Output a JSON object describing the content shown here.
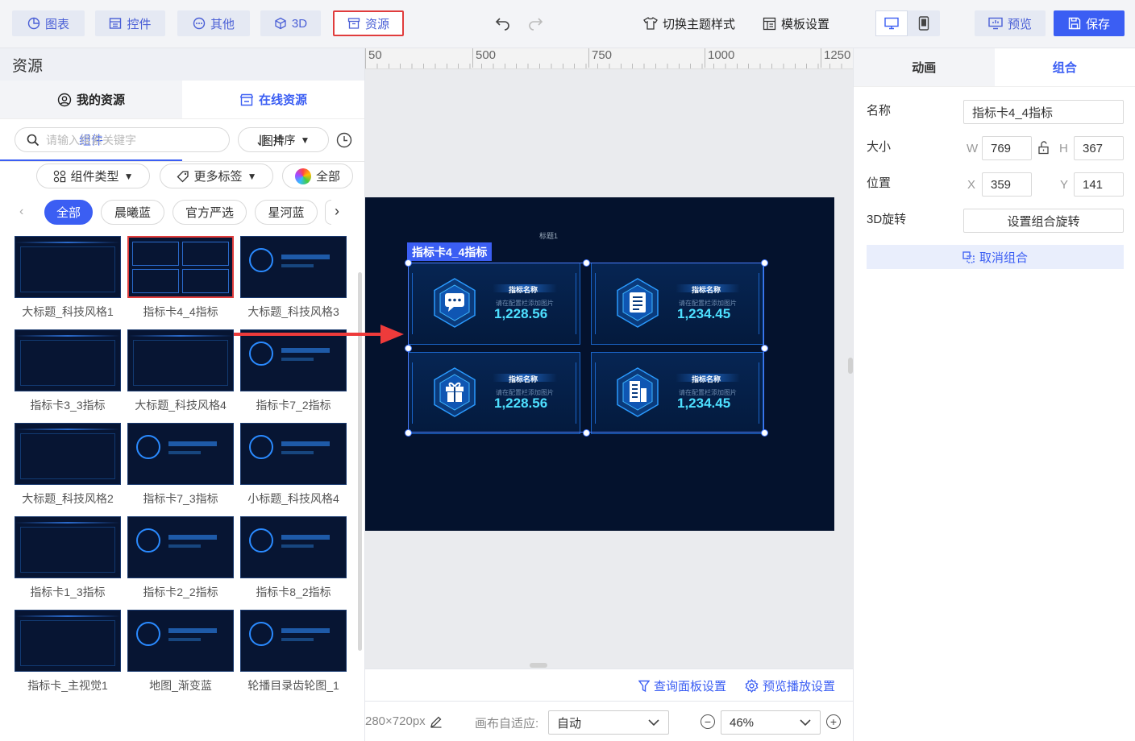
{
  "toolbar": {
    "tabs": [
      {
        "label": "图表",
        "icon": "chart-icon"
      },
      {
        "label": "控件",
        "icon": "widget-icon"
      },
      {
        "label": "其他",
        "icon": "more-icon"
      },
      {
        "label": "3D",
        "icon": "cube-icon"
      },
      {
        "label": "资源",
        "icon": "archive-icon"
      }
    ],
    "active_tab": "资源",
    "switch_theme": "切换主题样式",
    "template_settings": "模板设置",
    "preview": "预览",
    "save": "保存"
  },
  "left_panel": {
    "title": "资源",
    "source_tabs": {
      "mine": "我的资源",
      "online": "在线资源"
    },
    "sub_tabs": {
      "components": "组件",
      "images": "图片"
    },
    "search_placeholder": "请输入搜索关键字",
    "sort_label": "排序",
    "filters": {
      "type": "组件类型",
      "tags": "更多标签",
      "colors": "全部"
    },
    "chips": [
      "全部",
      "晨曦蓝",
      "官方严选",
      "星河蓝"
    ],
    "items": [
      {
        "caption": "大标题_科技风格1"
      },
      {
        "caption": "指标卡4_4指标",
        "selected": true
      },
      {
        "caption": "大标题_科技风格3"
      },
      {
        "caption": "指标卡3_3指标"
      },
      {
        "caption": "大标题_科技风格4"
      },
      {
        "caption": "指标卡7_2指标"
      },
      {
        "caption": "大标题_科技风格2"
      },
      {
        "caption": "指标卡7_3指标"
      },
      {
        "caption": "小标题_科技风格4"
      },
      {
        "caption": "指标卡1_3指标"
      },
      {
        "caption": "指标卡2_2指标"
      },
      {
        "caption": "指标卡8_2指标"
      },
      {
        "caption": "指标卡_主视觉1"
      },
      {
        "caption": "地图_渐变蓝"
      },
      {
        "caption": "轮播目录齿轮图_1"
      }
    ]
  },
  "canvas": {
    "ruler_marks": [
      "50",
      "500",
      "750",
      "1000",
      "1250"
    ],
    "screen_title": "标题1",
    "group_label": "指标卡4_4指标",
    "metrics": [
      {
        "name": "指标名称",
        "hint": "请在配置栏添加图片",
        "value": "1,228.56",
        "icon": "chat-icon"
      },
      {
        "name": "指标名称",
        "hint": "请在配置栏添加图片",
        "value": "1,234.45",
        "icon": "list-icon"
      },
      {
        "name": "指标名称",
        "hint": "请在配置栏添加图片",
        "value": "1,228.56",
        "icon": "gift-icon"
      },
      {
        "name": "指标名称",
        "hint": "请在配置栏添加图片",
        "value": "1,234.45",
        "icon": "building-icon"
      }
    ]
  },
  "bottom": {
    "query_panel": "查询面板设置",
    "preview_play": "预览播放设置",
    "resolution": "280×720px",
    "fit_label": "画布自适应:",
    "fit_value": "自动",
    "zoom": "46%"
  },
  "right_panel": {
    "tabs": {
      "animation": "动画",
      "group": "组合"
    },
    "name_label": "名称",
    "name_value": "指标卡4_4指标",
    "size_label": "大小",
    "w_prefix": "W",
    "w_value": "769",
    "h_prefix": "H",
    "h_value": "367",
    "pos_label": "位置",
    "x_prefix": "X",
    "x_value": "359",
    "y_prefix": "Y",
    "y_value": "141",
    "rotate_label": "3D旋转",
    "rotate_button": "设置组合旋转",
    "ungroup": "取消组合"
  },
  "colors": {
    "accent": "#3b5ef3",
    "highlight": "#e03c3c",
    "screen_bg": "#04122d",
    "metric_value": "#4ee0ff"
  }
}
